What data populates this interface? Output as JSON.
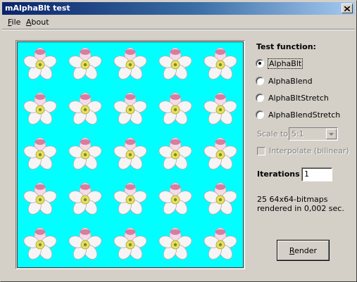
{
  "window": {
    "title": "mAlphaBlt test"
  },
  "menu": {
    "file": "File",
    "about": "About"
  },
  "panel": {
    "test_function_label": "Test function:",
    "options": [
      "AlphaBlt",
      "AlphaBlend",
      "AlphaBltStretch",
      "AlphaBlendStretch"
    ],
    "selected_option": "AlphaBlt",
    "scale_label": "Scale to",
    "scale_value": "5:1",
    "interpolate_label": "Interpolate (bilinear)",
    "interpolate_checked": false,
    "iterations_label": "Iterations",
    "iterations_value": "1",
    "result_line1": "25 64x64-bitmaps",
    "result_line2": "rendered in 0,002 sec.",
    "render_label": "Render"
  },
  "canvas": {
    "background": "#00ffff",
    "rows": 5,
    "cols": 5
  },
  "colors": {
    "title_start": "#0a246a",
    "title_end": "#a6caf0",
    "face": "#d4d0c8"
  },
  "icons": {
    "close": "close-icon",
    "combo_arrow": "chevron-down-icon",
    "tile": "flower-icon"
  }
}
